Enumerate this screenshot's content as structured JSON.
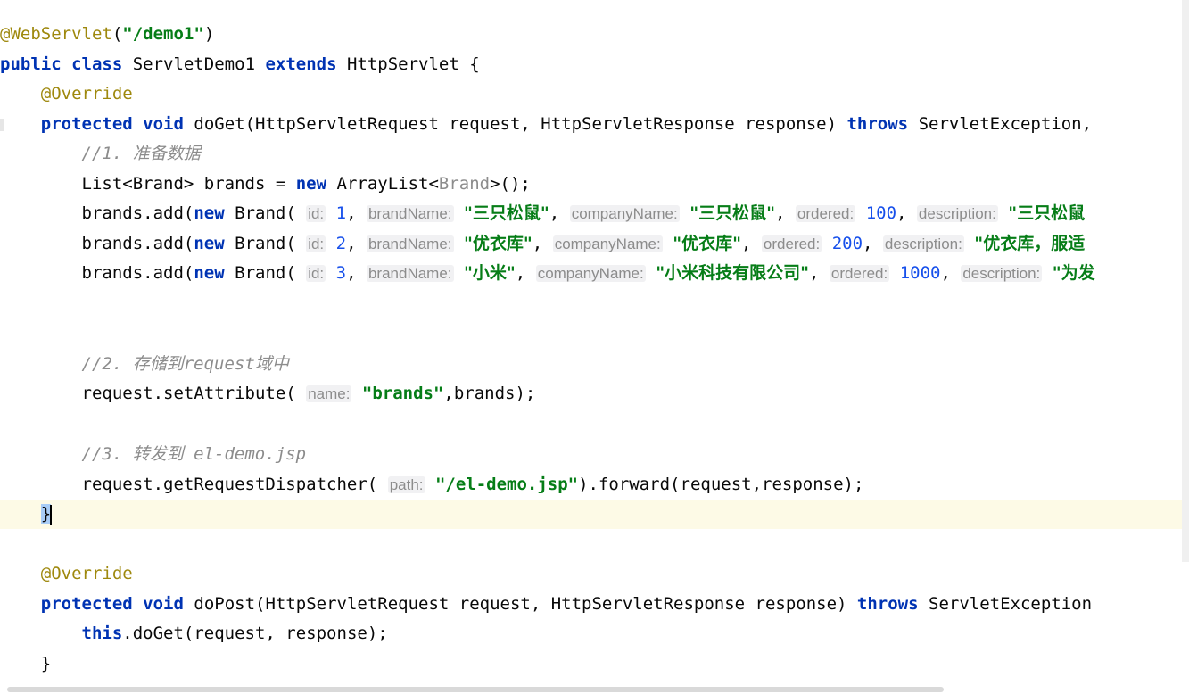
{
  "code": {
    "line1": {
      "annotation": "@WebServlet",
      "paren_open": "(",
      "path": "\"/demo1\"",
      "paren_close": ")"
    },
    "line2": {
      "kw_public": "public",
      "kw_class": "class",
      "class_name": " ServletDemo1 ",
      "kw_extends": "extends",
      "parent": " HttpServlet {"
    },
    "line3": {
      "annotation": "@Override"
    },
    "line4": {
      "kw_protected": "protected",
      "kw_void": "void",
      "signature": " doGet(HttpServletRequest request, HttpServletResponse response) ",
      "kw_throws": "throws",
      "exception": " ServletException,"
    },
    "line5": {
      "comment_prefix": "//1. ",
      "comment_text": "准备数据"
    },
    "line6": {
      "decl": "List<Brand> brands = ",
      "kw_new": "new",
      "type": " ArrayList<",
      "generic": "Brand",
      "end": ">();"
    },
    "brand_rows": [
      {
        "prefix": "brands.add(",
        "kw_new": "new",
        "ctor": " Brand( ",
        "hint_id": "id:",
        "id": "1",
        "hint_brand": "brandName:",
        "brand_name": "\"三只松鼠\"",
        "hint_company": "companyName:",
        "company_name": "\"三只松鼠\"",
        "hint_ordered": "ordered:",
        "ordered": "100",
        "hint_desc": "description:",
        "description": "\"三只松鼠"
      },
      {
        "prefix": "brands.add(",
        "kw_new": "new",
        "ctor": " Brand( ",
        "hint_id": "id:",
        "id": "2",
        "hint_brand": "brandName:",
        "brand_name": "\"优衣库\"",
        "hint_company": "companyName:",
        "company_name": "\"优衣库\"",
        "hint_ordered": "ordered:",
        "ordered": "200",
        "hint_desc": "description:",
        "description": "\"优衣库，服适"
      },
      {
        "prefix": "brands.add(",
        "kw_new": "new",
        "ctor": " Brand( ",
        "hint_id": "id:",
        "id": "3",
        "hint_brand": "brandName:",
        "brand_name": "\"小米\"",
        "hint_company": "companyName:",
        "company_name": "\"小米科技有限公司\"",
        "hint_ordered": "ordered:",
        "ordered": "1000",
        "hint_desc": "description:",
        "description": "\"为发"
      }
    ],
    "line12": {
      "comment_prefix": "//2. ",
      "comment_cjk1": "存储到",
      "comment_en": "request",
      "comment_cjk2": "域中"
    },
    "line13": {
      "call": "request.setAttribute( ",
      "hint_name": "name:",
      "attr_name": "\"brands\"",
      "end": ",brands);"
    },
    "line15": {
      "comment_prefix": "//3. ",
      "comment_cjk": "转发到",
      "comment_file": " el-demo.jsp"
    },
    "line16": {
      "call": "request.getRequestDispatcher( ",
      "hint_path": "path:",
      "path": "\"/el-demo.jsp\"",
      "end": ").forward(request,response);"
    },
    "line17": {
      "brace": "}"
    },
    "line19": {
      "annotation": "@Override"
    },
    "line20": {
      "kw_protected": "protected",
      "kw_void": "void",
      "signature": " doPost(HttpServletRequest request, HttpServletResponse response) ",
      "kw_throws": "throws",
      "exception": " ServletException"
    },
    "line21": {
      "kw_this": "this",
      "call": ".doGet(request, response);"
    },
    "line22": {
      "brace": "}"
    }
  },
  "colors": {
    "keyword": "#0033b3",
    "string": "#067d17",
    "number": "#1750eb",
    "annotation": "#9e880d",
    "comment": "#8c8c8c",
    "current_line": "#fdfae6"
  }
}
